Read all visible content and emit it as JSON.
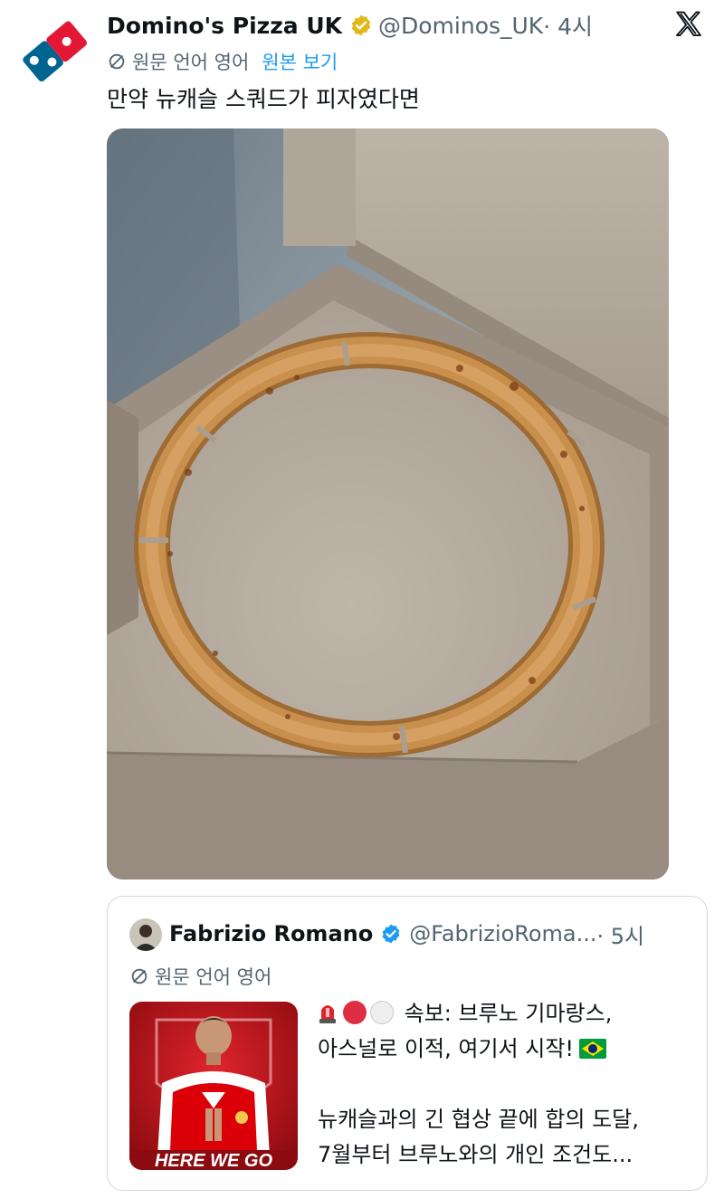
{
  "tweet": {
    "author_name": "Domino's Pizza UK",
    "handle": "@Dominos_UK",
    "time": "· 4시",
    "translated_from": "원문 언어 영어",
    "show_original": "원본 보기",
    "text": "만약 뉴캐슬 스쿼드가 피자였다면",
    "media_description": "Pizza box containing only the crust ring of a pizza",
    "platform_icon": "x-logo-icon",
    "verified_color": "#e2b719"
  },
  "quote": {
    "author_name": "Fabrizio Romano",
    "handle": "@FabrizioRoma...",
    "time": "· 5시",
    "translated_from": "원문 언어 영어",
    "verified_color": "#1d9bf0",
    "lines": [
      "속보: 브루노 기마랑스,",
      "아스널로 이적, 여기서 시작!",
      "",
      "뉴캐슬과의 긴 협상 끝에 합의 도달,",
      "7월부터 브루노와의 개인 조건도..."
    ],
    "thumbnail_caption": "HERE WE GO"
  },
  "colors": {
    "link": "#1d9bf0",
    "secondary_text": "#536471",
    "primary_text": "#0f1419",
    "dominos_blue": "#006491",
    "dominos_red": "#e31837"
  }
}
